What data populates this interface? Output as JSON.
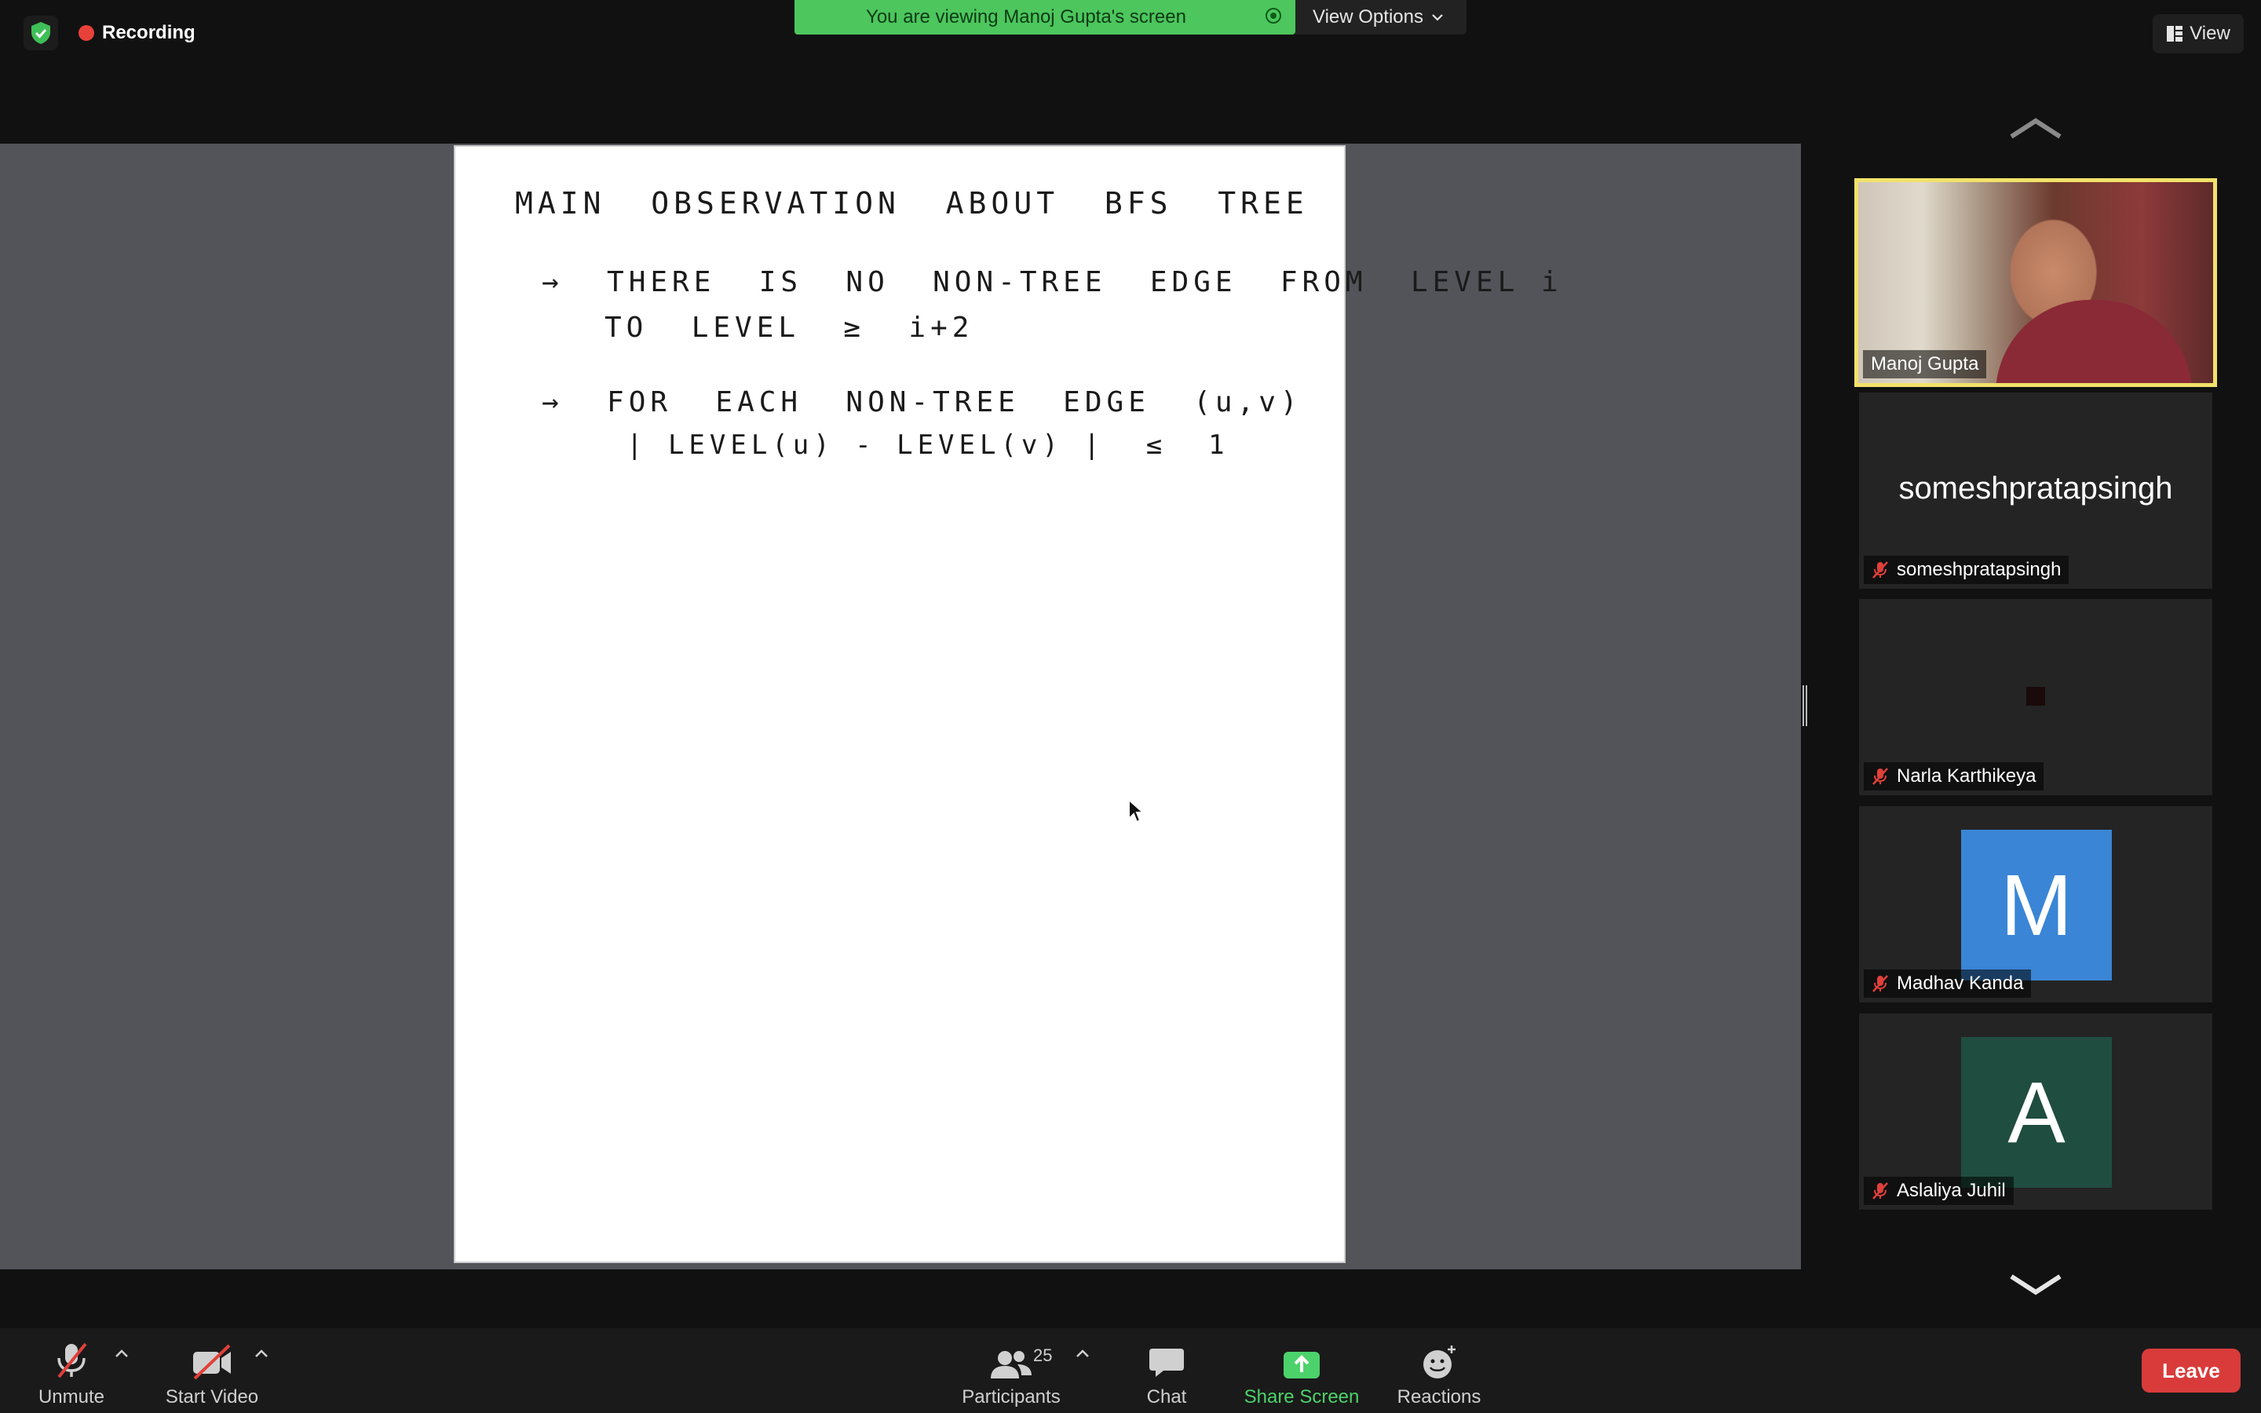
{
  "top_bar": {
    "recording_label": "Recording",
    "viewing_banner": "You are viewing Manoj Gupta's screen",
    "view_options_label": "View Options",
    "view_button_label": "View"
  },
  "shared_screen": {
    "lines": [
      "MAIN  OBSERVATION  ABOUT  BFS  TREE",
      "→  THERE  IS  NO  NON-TREE  EDGE  FROM  LEVEL i",
      "TO  LEVEL  ≥  i+2",
      "→  FOR  EACH  NON-TREE  EDGE  (u,v)",
      "| LEVEL(u) - LEVEL(v) |  ≤  1"
    ]
  },
  "participants": [
    {
      "name": "Manoj Gupta",
      "video": true,
      "muted": false,
      "active_speaker": true
    },
    {
      "name": "someshpratapsingh",
      "display_text": "someshpratapsingh",
      "muted": true
    },
    {
      "name": "Narla Karthikeya",
      "muted": true
    },
    {
      "name": "Madhav Kanda",
      "avatar_letter": "M",
      "avatar_color": "#3a85d6",
      "muted": true
    },
    {
      "name": "Aslaliya Juhil",
      "avatar_letter": "A",
      "avatar_color": "#1f4d3f",
      "muted": true
    }
  ],
  "toolbar": {
    "unmute_label": "Unmute",
    "start_video_label": "Start Video",
    "participants_label": "Participants",
    "participants_count": "25",
    "chat_label": "Chat",
    "share_screen_label": "Share Screen",
    "reactions_label": "Reactions",
    "leave_label": "Leave"
  },
  "colors": {
    "accent_green": "#4cc65d",
    "leave_red": "#d93b3b",
    "active_speaker_border": "#f2e26a",
    "muted_icon_red": "#e0403a"
  },
  "icons": [
    "shield-check-icon",
    "recording-dot-icon",
    "chevron-down-icon",
    "view-grid-icon",
    "chevron-up-icon",
    "mic-muted-icon",
    "video-off-icon",
    "participants-icon",
    "chat-icon",
    "share-screen-icon",
    "reactions-icon",
    "mouse-pointer-icon"
  ]
}
